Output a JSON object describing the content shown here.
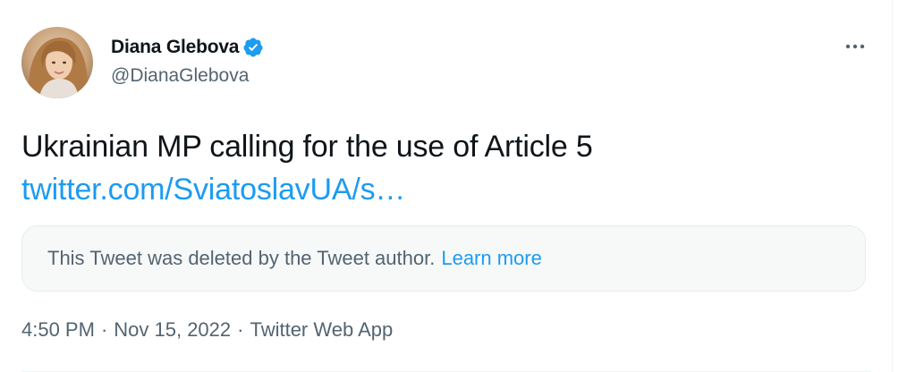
{
  "author": {
    "display_name": "Diana Glebova",
    "handle": "@DianaGlebova",
    "verified": true
  },
  "tweet": {
    "text_line1": "Ukrainian MP calling for the use of Article 5",
    "link_text": "twitter.com/SviatoslavUA/s…"
  },
  "quoted": {
    "deleted_text": "This Tweet was deleted by the Tweet author.",
    "learn_more": "Learn more"
  },
  "meta": {
    "time": "4:50 PM",
    "separator": "·",
    "date": "Nov 15, 2022",
    "source": "Twitter Web App"
  },
  "icons": {
    "verified": "verified-badge-icon",
    "more": "more-horizontal-icon"
  },
  "colors": {
    "link": "#1d9bf0",
    "secondary_text": "#536471",
    "primary_text": "#0f1419",
    "box_background": "#f7f9f9"
  }
}
